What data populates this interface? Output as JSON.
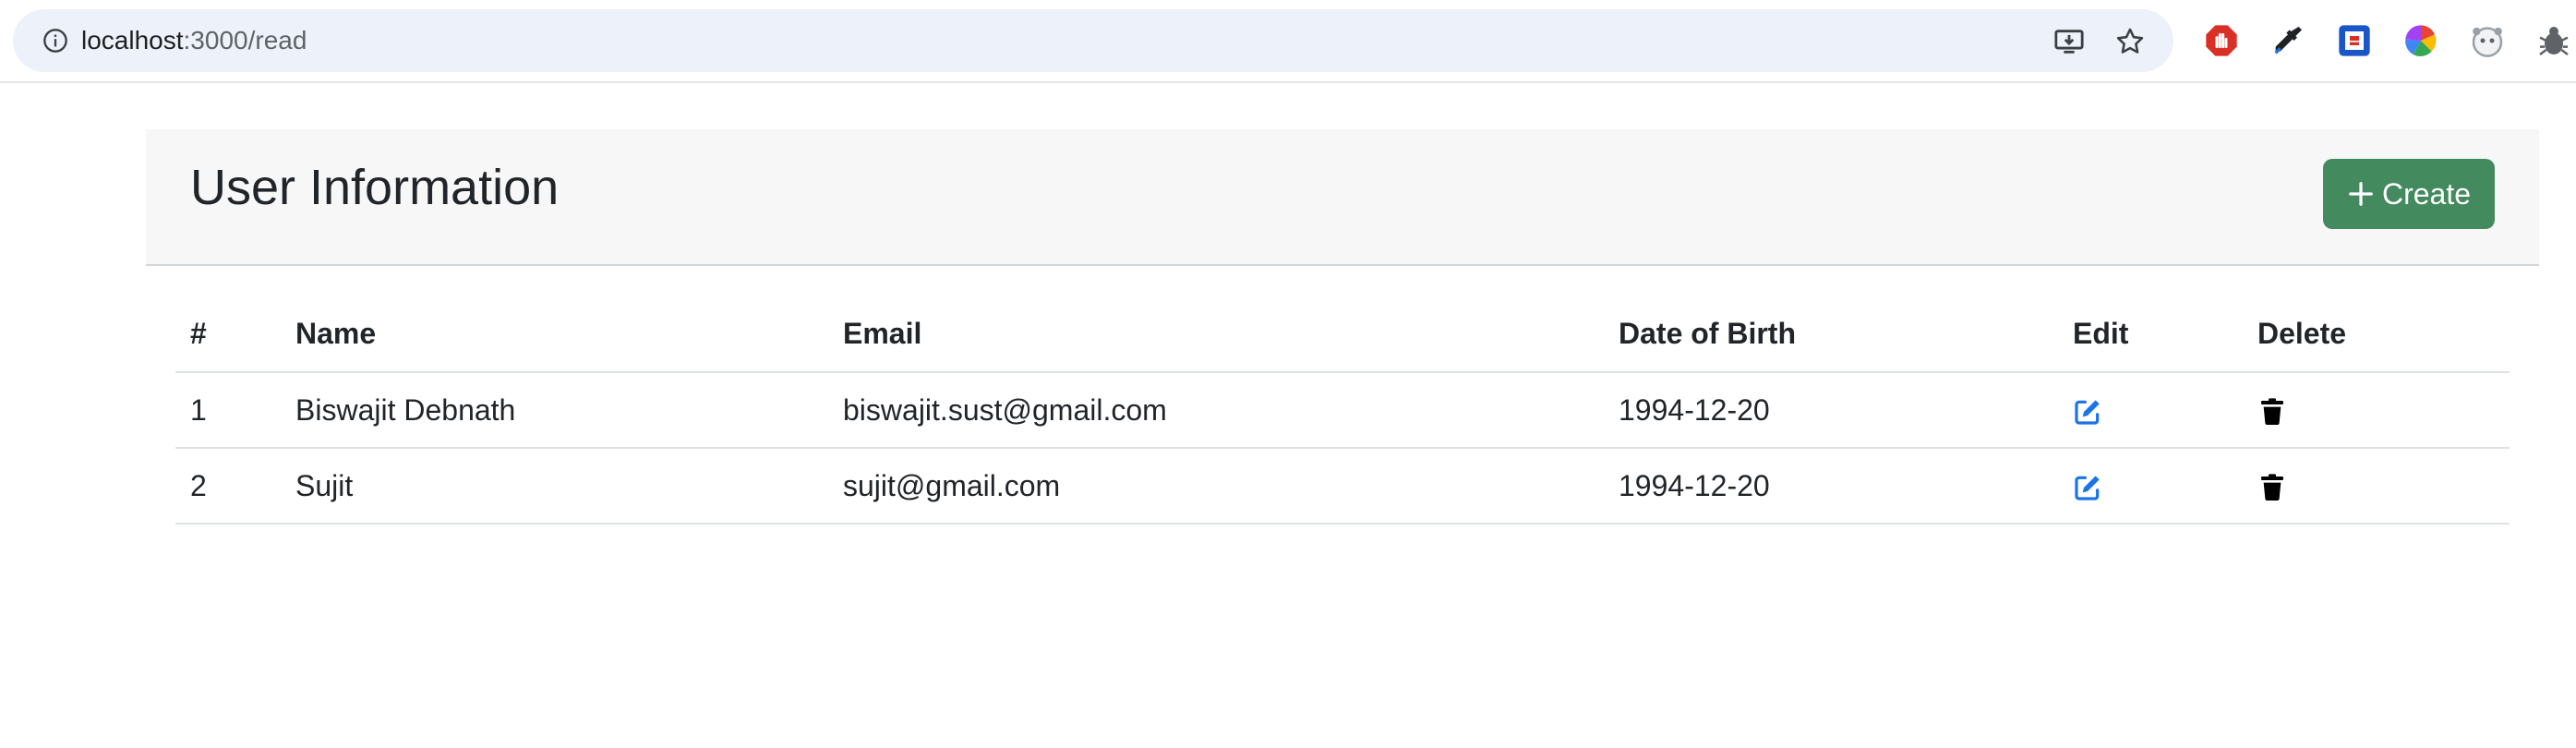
{
  "browser": {
    "url_host": "localhost",
    "url_rest": ":3000/read",
    "icons": [
      "info-circle-icon",
      "install-app-icon",
      "bookmark-star-icon"
    ],
    "extensions": [
      "adblock-extension-icon",
      "color-picker-extension-icon",
      "screen-capture-extension-icon",
      "color-wheel-extension-icon",
      "panda-extension-icon",
      "bug-extension-icon"
    ]
  },
  "header": {
    "title": "User Information",
    "create_label": "Create"
  },
  "table": {
    "columns": {
      "num": "#",
      "name": "Name",
      "email": "Email",
      "dob": "Date of Birth",
      "edit": "Edit",
      "delete": "Delete"
    },
    "rows": [
      {
        "num": "1",
        "name": "Biswajit Debnath",
        "email": "biswajit.sust@gmail.com",
        "dob": "1994-12-20"
      },
      {
        "num": "2",
        "name": "Sujit",
        "email": "sujit@gmail.com",
        "dob": "1994-12-20"
      }
    ]
  },
  "colors": {
    "create_button": "#438a5e",
    "edit_icon": "#1a73e8",
    "delete_icon": "#000000",
    "card_background": "#f7f7f7"
  }
}
